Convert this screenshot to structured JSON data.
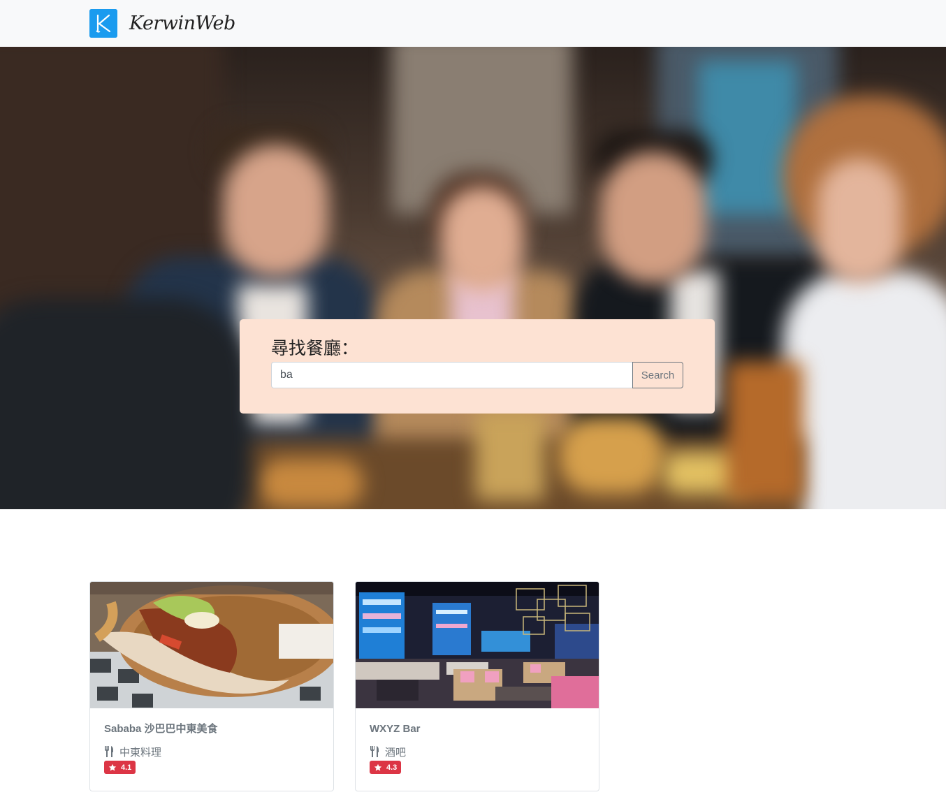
{
  "navbar": {
    "brand_letter": "K",
    "brand_name": "KerwinWeb"
  },
  "search": {
    "title": "尋找餐廳：",
    "value": "ba",
    "button_label": "Search"
  },
  "results": [
    {
      "name": "Sababa 沙巴巴中東美食",
      "category": "中東料理",
      "rating": "4.1"
    },
    {
      "name": "WXYZ Bar",
      "category": "酒吧",
      "rating": "4.3"
    }
  ],
  "colors": {
    "brand_blue": "#1a9bef",
    "search_panel_bg": "#fde2d3",
    "rating_badge": "#dc3545"
  },
  "icons": {
    "category": "utensils-icon",
    "rating": "star-icon"
  }
}
